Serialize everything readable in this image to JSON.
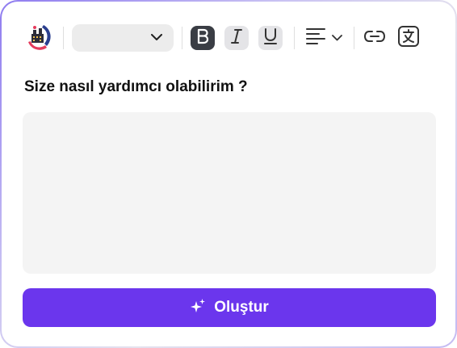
{
  "toolbar": {
    "logo_icon": "brand-logo-icon",
    "font_select": {
      "value": "",
      "icon": "chevron-down-icon"
    },
    "bold_icon": "bold-icon",
    "italic_icon": "italic-icon",
    "underline_icon": "underline-icon",
    "align": {
      "icon": "align-left-icon",
      "dropdown_icon": "chevron-down-icon"
    },
    "link_icon": "link-icon",
    "translate_icon": "translate-icon"
  },
  "prompt": {
    "question": "Size nasıl yardımcı olabilirim ?",
    "input_value": "",
    "input_placeholder": ""
  },
  "create_button": {
    "label": "Oluştur",
    "icon": "sparkles-icon"
  },
  "colors": {
    "accent": "#6b36ed",
    "bold_active": "#3a3d44",
    "input_bg": "#f4f4f4"
  }
}
